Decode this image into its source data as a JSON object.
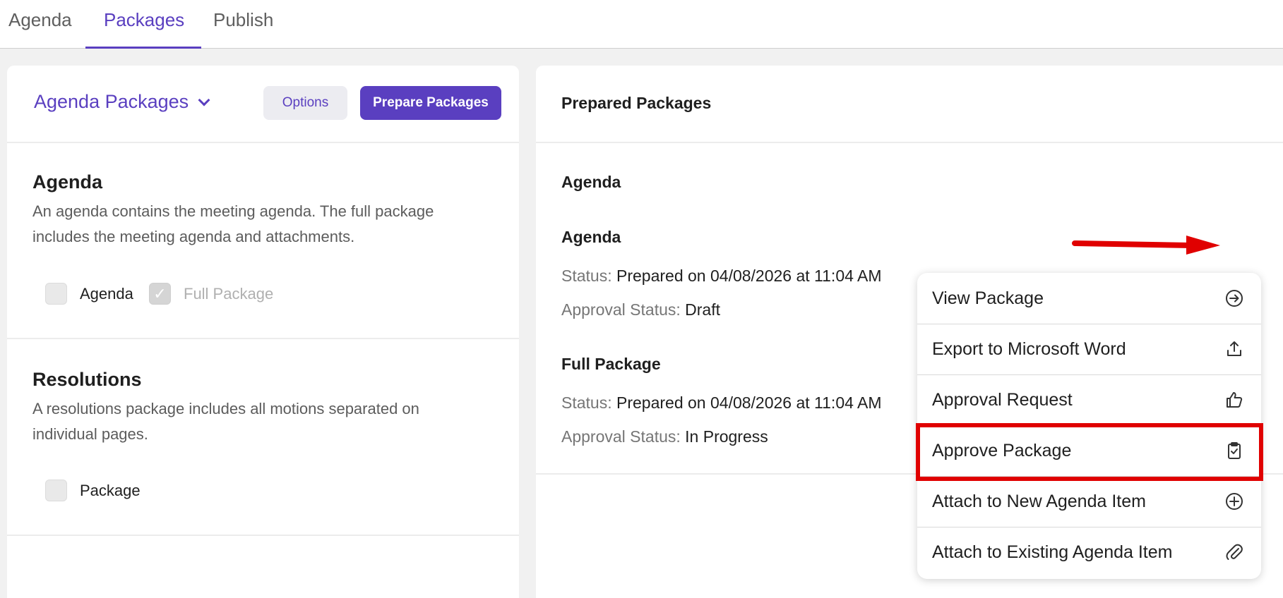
{
  "tabs": [
    {
      "label": "Agenda"
    },
    {
      "label": "Packages"
    },
    {
      "label": "Publish"
    }
  ],
  "left_panel": {
    "selector_label": "Agenda Packages",
    "options_label": "Options",
    "prepare_label": "Prepare Packages",
    "sections": [
      {
        "title": "Agenda",
        "description": "An agenda contains the meeting agenda. The full package includes the meeting agenda and attachments.",
        "checkboxes": [
          {
            "label": "Agenda",
            "checked": false,
            "disabled": false
          },
          {
            "label": "Full Package",
            "checked": true,
            "disabled": true
          }
        ]
      },
      {
        "title": "Resolutions",
        "description": "A resolutions package includes all motions separated on individual pages.",
        "checkboxes": [
          {
            "label": "Package",
            "checked": false,
            "disabled": false
          }
        ]
      }
    ]
  },
  "right_panel": {
    "title": "Prepared Packages",
    "group_title": "Agenda",
    "packages": [
      {
        "name": "Agenda",
        "status_label": "Status:",
        "status_value": "Prepared on 04/08/2026 at 11:04 AM",
        "approval_label": "Approval Status:",
        "approval_value": "Draft"
      },
      {
        "name": "Full Package",
        "status_label": "Status:",
        "status_value": "Prepared on 04/08/2026 at 11:04 AM",
        "approval_label": "Approval Status:",
        "approval_value": "In Progress"
      }
    ]
  },
  "context_menu": {
    "items": [
      {
        "label": "View Package",
        "icon": "arrow-circle-right-icon"
      },
      {
        "label": "Export to Microsoft Word",
        "icon": "upload-icon"
      },
      {
        "label": "Approval Request",
        "icon": "thumbs-up-icon"
      },
      {
        "label": "Approve Package",
        "icon": "clipboard-check-icon"
      },
      {
        "label": "Attach to New Agenda Item",
        "icon": "plus-circle-icon"
      },
      {
        "label": "Attach to Existing Agenda Item",
        "icon": "paperclip-icon"
      }
    ]
  },
  "colors": {
    "accent": "#5a3fc0",
    "annotation": "#e00000"
  }
}
